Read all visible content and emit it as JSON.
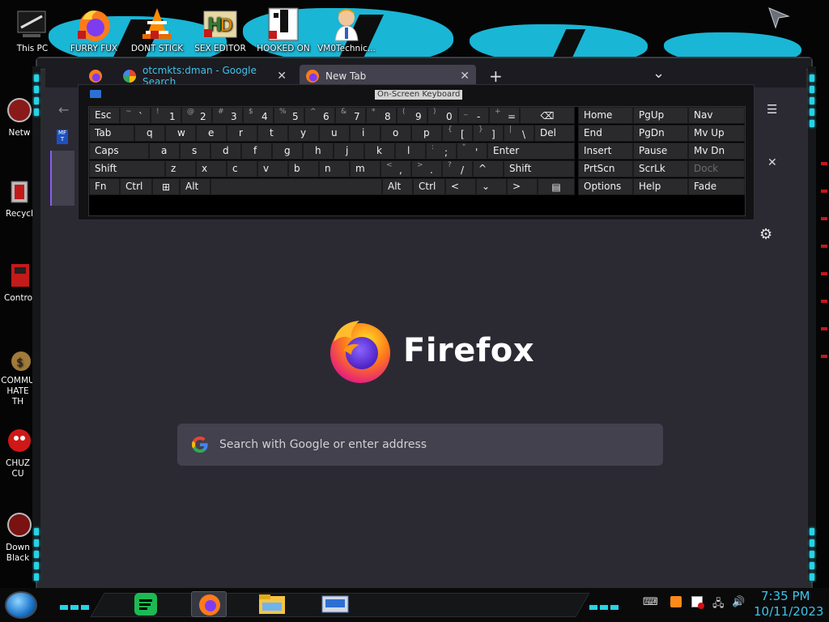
{
  "desktop": {
    "top_icons": [
      {
        "label": "This PC",
        "icon": "computer-icon"
      },
      {
        "label": "FURRY FUX",
        "icon": "firefox-icon"
      },
      {
        "label": "DONT STICK",
        "icon": "vlc-icon"
      },
      {
        "label": "SEX EDITOR",
        "icon": "hex-editor-icon"
      },
      {
        "label": "HOOKED ON",
        "icon": "game-icon"
      },
      {
        "label": "VM0Technic...",
        "icon": "technician-icon"
      }
    ],
    "left_icons": [
      {
        "label": "Netw",
        "icon": "network-icon"
      },
      {
        "label": "Recycl",
        "icon": "recycle-bin-icon"
      },
      {
        "label": "Control",
        "icon": "control-panel-icon"
      },
      {
        "label": "COMMU HATE TH",
        "icon": "money-bag-icon"
      },
      {
        "label": "CHUZ CU",
        "icon": "character-icon"
      },
      {
        "label": "Down Black",
        "icon": "download-icon"
      }
    ]
  },
  "browser": {
    "tabs": [
      {
        "label": "",
        "icon": "firefox-icon"
      },
      {
        "label": "otcmkts:dman - Google Search",
        "icon": "google-icon",
        "close": "✕"
      },
      {
        "label": "New Tab",
        "icon": "firefox-icon",
        "close": "✕",
        "active": true
      }
    ],
    "new_tab_button": "+",
    "tab_list_button": "⌄",
    "brand_word": "Firefox",
    "search_placeholder": "Search with Google or enter address",
    "menu_icon": "hamburger-menu-icon",
    "settings_icon": "gear-icon",
    "extension_badge": "MF T"
  },
  "osk": {
    "title": "On-Screen Keyboard",
    "row1": [
      {
        "main": "Esc"
      },
      {
        "main": "`",
        "shift": "~"
      },
      {
        "main": "1",
        "shift": "!"
      },
      {
        "main": "2",
        "shift": "@"
      },
      {
        "main": "3",
        "shift": "#"
      },
      {
        "main": "4",
        "shift": "$"
      },
      {
        "main": "5",
        "shift": "%"
      },
      {
        "main": "6",
        "shift": "^"
      },
      {
        "main": "7",
        "shift": "&"
      },
      {
        "main": "8",
        "shift": "*"
      },
      {
        "main": "9",
        "shift": "("
      },
      {
        "main": "0",
        "shift": ")"
      },
      {
        "main": "-",
        "shift": "_"
      },
      {
        "main": "=",
        "shift": "+"
      },
      {
        "main": "⌫"
      }
    ],
    "row2": [
      {
        "main": "Tab"
      },
      {
        "main": "q"
      },
      {
        "main": "w"
      },
      {
        "main": "e"
      },
      {
        "main": "r"
      },
      {
        "main": "t"
      },
      {
        "main": "y"
      },
      {
        "main": "u"
      },
      {
        "main": "i"
      },
      {
        "main": "o"
      },
      {
        "main": "p"
      },
      {
        "main": "[",
        "shift": "{"
      },
      {
        "main": "]",
        "shift": "}"
      },
      {
        "main": "\\",
        "shift": "|"
      },
      {
        "main": "Del"
      }
    ],
    "row3": [
      {
        "main": "Caps"
      },
      {
        "main": "a"
      },
      {
        "main": "s"
      },
      {
        "main": "d"
      },
      {
        "main": "f"
      },
      {
        "main": "g"
      },
      {
        "main": "h"
      },
      {
        "main": "j"
      },
      {
        "main": "k"
      },
      {
        "main": "l"
      },
      {
        "main": ";",
        "shift": ":"
      },
      {
        "main": "'",
        "shift": "\""
      },
      {
        "main": "Enter"
      }
    ],
    "row4": [
      {
        "main": "Shift"
      },
      {
        "main": "z"
      },
      {
        "main": "x"
      },
      {
        "main": "c"
      },
      {
        "main": "v"
      },
      {
        "main": "b"
      },
      {
        "main": "n"
      },
      {
        "main": "m"
      },
      {
        "main": ",",
        "shift": "<"
      },
      {
        "main": ".",
        "shift": ">"
      },
      {
        "main": "/",
        "shift": "?"
      },
      {
        "main": "^"
      },
      {
        "main": "Shift"
      }
    ],
    "row5": [
      {
        "main": "Fn"
      },
      {
        "main": "Ctrl"
      },
      {
        "main": "⊞"
      },
      {
        "main": "Alt"
      },
      {
        "main": ""
      },
      {
        "main": "Alt"
      },
      {
        "main": "Ctrl"
      },
      {
        "main": "<"
      },
      {
        "main": "⌄"
      },
      {
        "main": ">"
      },
      {
        "main": "▤"
      }
    ],
    "nav_rows": [
      [
        "Home",
        "PgUp",
        "Nav"
      ],
      [
        "End",
        "PgDn",
        "Mv Up"
      ],
      [
        "Insert",
        "Pause",
        "Mv Dn"
      ],
      [
        "PrtScn",
        "ScrLk",
        "Dock"
      ],
      [
        "Options",
        "Help",
        "Fade"
      ]
    ]
  },
  "taskbar": {
    "apps": [
      "spotify-icon",
      "firefox-icon",
      "file-explorer-icon",
      "on-screen-keyboard-icon"
    ],
    "tray_icons": [
      "keyboard-icon",
      "firefox-update-icon",
      "flag-icon",
      "network-icon",
      "volume-icon"
    ],
    "time": "7:35 PM",
    "date": "10/11/2023"
  },
  "colors": {
    "accent": "#26d3e6",
    "clock": "#3fc3e8",
    "search_bg": "#42414d",
    "page_bg": "#2b2a33"
  }
}
